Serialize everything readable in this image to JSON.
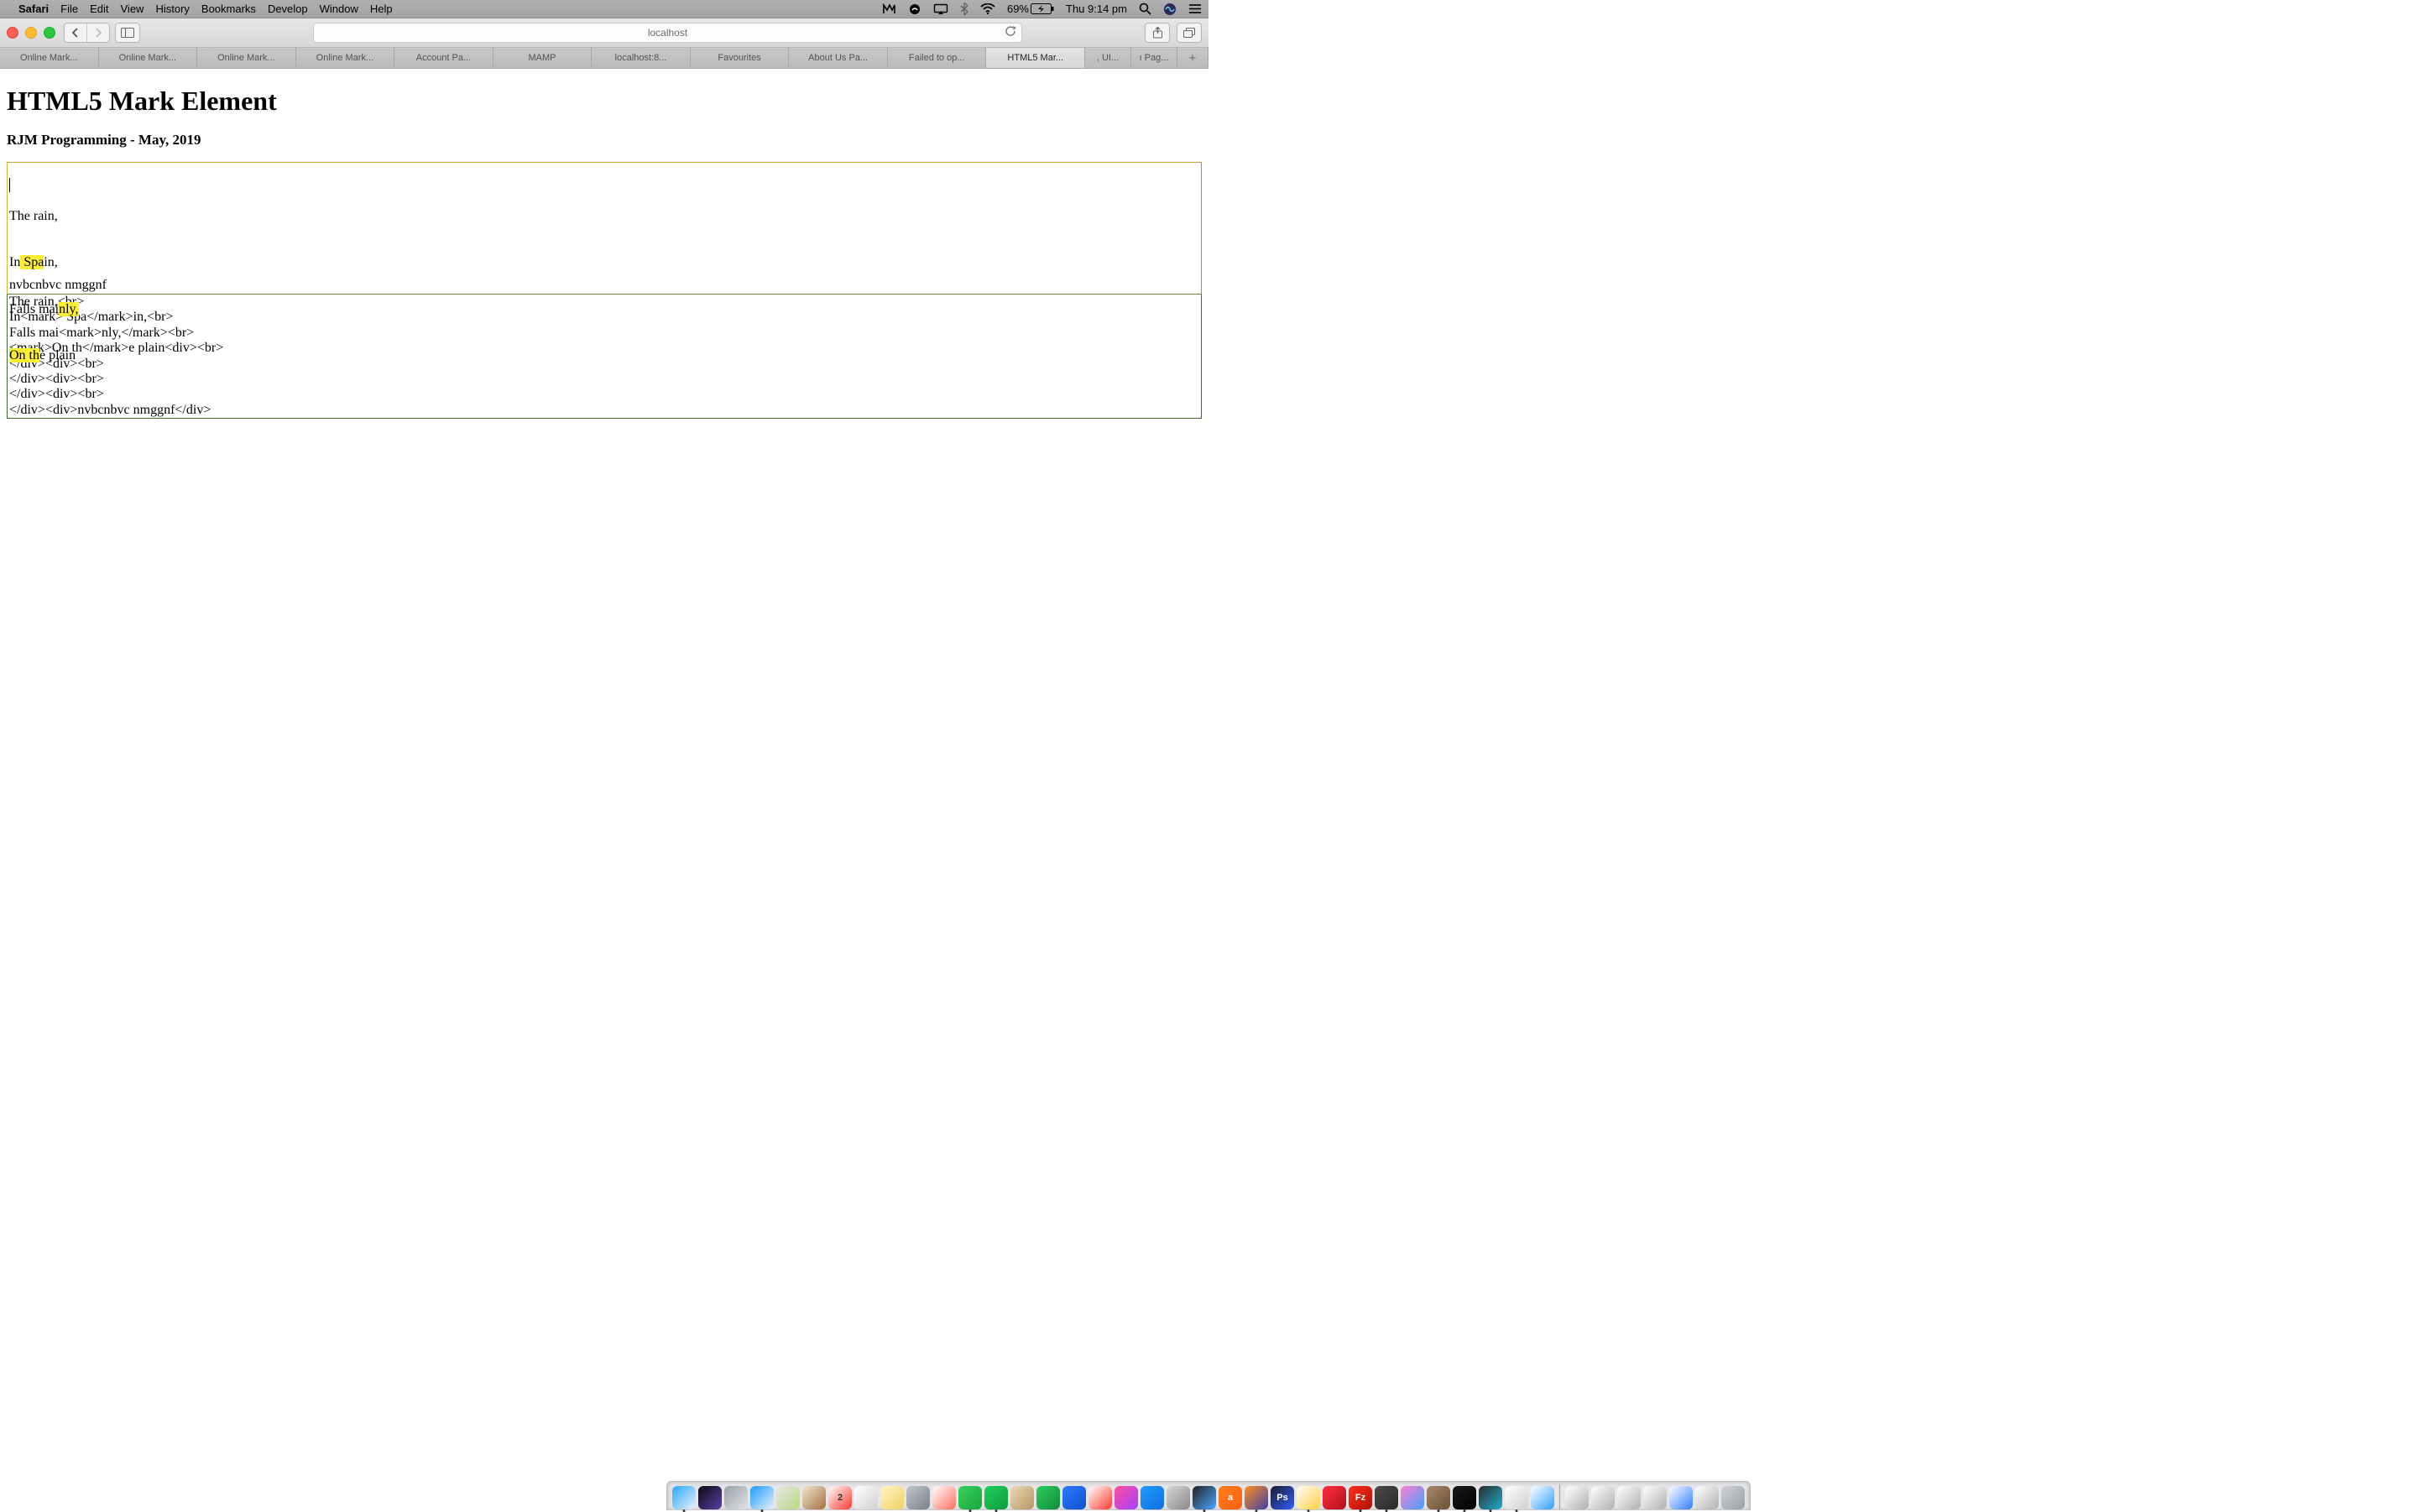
{
  "menubar": {
    "app": "Safari",
    "items": [
      "File",
      "Edit",
      "View",
      "History",
      "Bookmarks",
      "Develop",
      "Window",
      "Help"
    ],
    "battery": "69%",
    "clock": "Thu 9:14 pm"
  },
  "toolbar": {
    "url": "localhost"
  },
  "tabs": [
    {
      "label": "Online Mark..."
    },
    {
      "label": "Online Mark..."
    },
    {
      "label": "Online Mark..."
    },
    {
      "label": "Online Mark..."
    },
    {
      "label": "Account Pa..."
    },
    {
      "label": "MAMP"
    },
    {
      "label": "localhost:8..."
    },
    {
      "label": "Favourites"
    },
    {
      "label": "About Us Pa..."
    },
    {
      "label": "Failed to op..."
    },
    {
      "label": "HTML5 Mar...",
      "active": true
    },
    {
      "label": ", UI...",
      "small": true
    },
    {
      "label": "ı Pag...",
      "small": true
    }
  ],
  "page": {
    "h1": "HTML5 Mark Element",
    "h3": "RJM Programming - May, 2019",
    "rendered": {
      "l1_a": "The rain,",
      "l2_a": "In",
      "l2_m": " Spa",
      "l2_b": "in,",
      "l3_a": "Falls mai",
      "l3_m": "nly,",
      "l4_m": "On th",
      "l4_b": "e plain",
      "tail": "nvbcnbvc nmggnf"
    },
    "source": "The rain,<br>\nIn<mark> Spa</mark>in,<br>\nFalls mai<mark>nly,</mark><br>\n<mark>On th</mark>e plain<div><br>\n</div><div><br>\n</div><div><br>\n</div><div><br>\n</div><div>nvbcnbvc nmggnf</div>"
  },
  "dock": [
    {
      "name": "finder",
      "c1": "#27a7ff",
      "c2": "#eceff4",
      "run": true
    },
    {
      "name": "siri",
      "c1": "#0b0b0f",
      "c2": "#5b3fa8"
    },
    {
      "name": "launchpad",
      "c1": "#9aa1a7",
      "c2": "#dfe3e7"
    },
    {
      "name": "safari",
      "c1": "#1a9bff",
      "c2": "#e8f3fb",
      "run": true
    },
    {
      "name": "maps",
      "c1": "#e7e7e7",
      "c2": "#b8d980"
    },
    {
      "name": "bean",
      "c1": "#f1e6cf",
      "c2": "#a17040"
    },
    {
      "name": "calendar",
      "c1": "#ffffff",
      "c2": "#ff3b30",
      "txt": "2"
    },
    {
      "name": "reminders",
      "c1": "#ffffff",
      "c2": "#d0d0d0"
    },
    {
      "name": "notes",
      "c1": "#fff6c8",
      "c2": "#f0d060"
    },
    {
      "name": "automator",
      "c1": "#bfc6cc",
      "c2": "#7a8187"
    },
    {
      "name": "photos",
      "c1": "#ffffff",
      "c2": "#ff6f61"
    },
    {
      "name": "messages",
      "c1": "#36d15b",
      "c2": "#1aa63d",
      "run": true
    },
    {
      "name": "facetime",
      "c1": "#1dd15b",
      "c2": "#0f9a3a",
      "run": true
    },
    {
      "name": "contacts",
      "c1": "#e9d9b8",
      "c2": "#b89660"
    },
    {
      "name": "numbers",
      "c1": "#2fcf5e",
      "c2": "#0f8a3a"
    },
    {
      "name": "keynote",
      "c1": "#2f7bff",
      "c2": "#0f4fcf"
    },
    {
      "name": "noentry",
      "c1": "#ffffff",
      "c2": "#ff3b30"
    },
    {
      "name": "itunes",
      "c1": "#ff4f9d",
      "c2": "#a63fff"
    },
    {
      "name": "appstore",
      "c1": "#1f9bff",
      "c2": "#0f6fdf"
    },
    {
      "name": "settings",
      "c1": "#d5d5d7",
      "c2": "#8a8a8d"
    },
    {
      "name": "activity",
      "c1": "#222",
      "c2": "#4aa3ff",
      "run": true
    },
    {
      "name": "avast",
      "c1": "#ff7f1f",
      "c2": "#ff5f0f",
      "txt": "a"
    },
    {
      "name": "firefox",
      "c1": "#ff8f1f",
      "c2": "#3f3fa8",
      "run": true
    },
    {
      "name": "photoshop",
      "c1": "#1b1b2b",
      "c2": "#2f5fff",
      "txt": "Ps"
    },
    {
      "name": "chrome",
      "c1": "#ffffff",
      "c2": "#ffcf3f",
      "run": true
    },
    {
      "name": "opera",
      "c1": "#ff2f3f",
      "c2": "#b01020"
    },
    {
      "name": "filezilla",
      "c1": "#ff2f1f",
      "c2": "#b01000",
      "txt": "Fz",
      "run": true
    },
    {
      "name": "mamp",
      "c1": "#4a4a4a",
      "c2": "#2a2a2a",
      "run": true
    },
    {
      "name": "paint",
      "c1": "#ff7fcf",
      "c2": "#3f9fff"
    },
    {
      "name": "gimp",
      "c1": "#a9896a",
      "c2": "#6b4f34",
      "run": true
    },
    {
      "name": "terminal",
      "c1": "#1a1a1a",
      "c2": "#000",
      "run": true
    },
    {
      "name": "quicktime",
      "c1": "#2a2a2a",
      "c2": "#1faed1",
      "run": true
    },
    {
      "name": "textedit",
      "c1": "#ffffff",
      "c2": "#cfcfcf",
      "run": true
    },
    {
      "name": "preview",
      "c1": "#ffffff",
      "c2": "#2f9fff"
    },
    {
      "name": "doc1",
      "c1": "#ffffff",
      "c2": "#b0b0b0"
    },
    {
      "name": "doc2",
      "c1": "#ffffff",
      "c2": "#b0b0b0"
    },
    {
      "name": "doc3",
      "c1": "#ffffff",
      "c2": "#b0b0b0"
    },
    {
      "name": "doc4",
      "c1": "#ffffff",
      "c2": "#b0b0b0"
    },
    {
      "name": "doc5",
      "c1": "#ffffff",
      "c2": "#2f7fff"
    },
    {
      "name": "doc6",
      "c1": "#ffffff",
      "c2": "#b0b0b0"
    },
    {
      "name": "trash",
      "c1": "#cfd3d7",
      "c2": "#9aa0a6"
    }
  ]
}
